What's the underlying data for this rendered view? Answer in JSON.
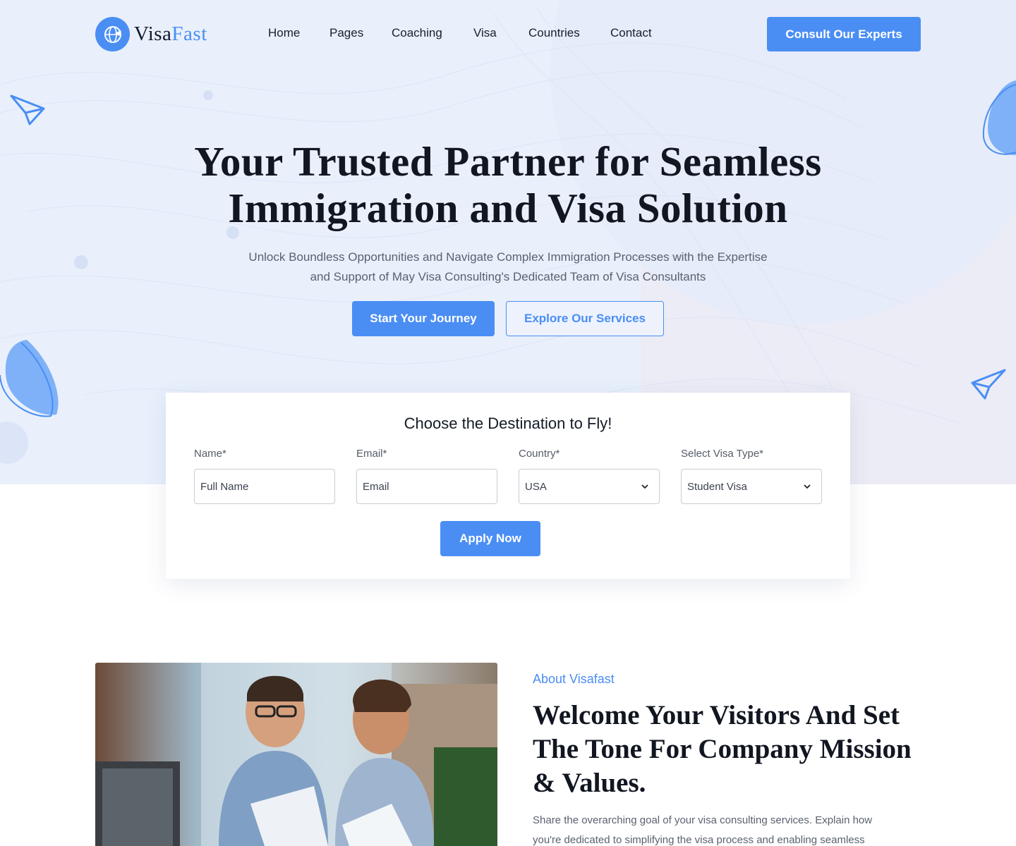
{
  "brand": {
    "name_part1": "Visa",
    "name_part2": "Fast",
    "accent": "#4a8ef4",
    "icon": "globe-plane-icon"
  },
  "nav": {
    "items": [
      {
        "label": "Home"
      },
      {
        "label": "Pages"
      },
      {
        "label": "Coaching"
      },
      {
        "label": "Visa"
      },
      {
        "label": "Countries"
      },
      {
        "label": "Contact"
      }
    ],
    "cta_label": "Consult Our Experts"
  },
  "hero": {
    "title_line1": "Your Trusted Partner for Seamless",
    "title_line2": "Immigration and Visa Solution",
    "subtitle_line1": "Unlock Boundless Opportunities and Navigate Complex Immigration Processes with the Expertise",
    "subtitle_line2": "and Support of May Visa Consulting's Dedicated Team of Visa Consultants",
    "primary_label": "Start Your Journey",
    "secondary_label": "Explore Our Services"
  },
  "form": {
    "title": "Choose the Destination to Fly!",
    "fields": [
      {
        "label": "Name*",
        "value": "Full Name"
      },
      {
        "label": "Email*",
        "value": "Email"
      },
      {
        "label": "Country*",
        "value": "USA"
      },
      {
        "label": "Select Visa Type*",
        "value": "Student Visa"
      }
    ],
    "submit_label": "Apply Now"
  },
  "about": {
    "eyebrow": "About Visafast",
    "title_line1": "Welcome Your Visitors And Set",
    "title_line2": "The Tone For Company Mission",
    "title_line3": "& Values.",
    "body_line1": "Share the overarching goal of your visa consulting services. Explain how",
    "body_line2": "you're dedicated to simplifying the visa process and enabling seamless"
  }
}
